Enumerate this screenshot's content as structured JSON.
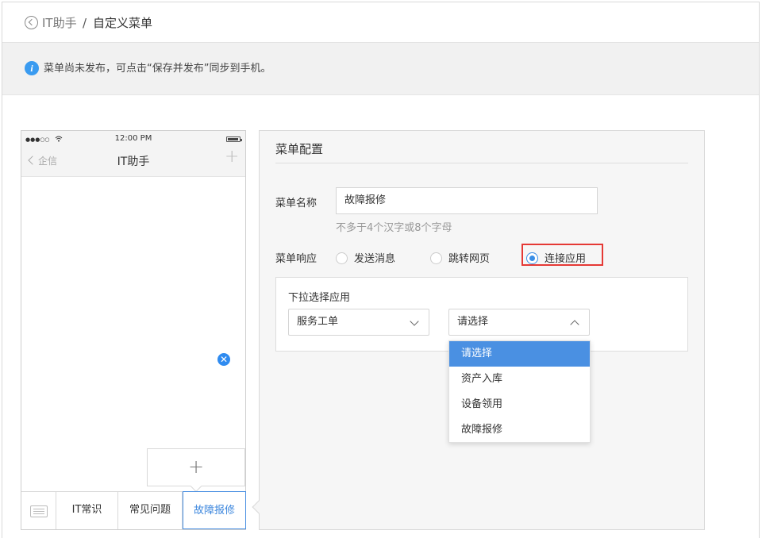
{
  "header": {
    "breadcrumb_link": "IT助手",
    "separator": "/",
    "current": "自定义菜单"
  },
  "notice": {
    "text": "菜单尚未发布，可点击“保存并发布”同步到手机。"
  },
  "phone": {
    "signal": "●●●○○",
    "time": "12:00 PM",
    "nav_back": "企信",
    "nav_title": "IT助手",
    "nav_plus": "+",
    "add_plus": "+",
    "tabs": [
      "IT常识",
      "常见问题",
      "故障报修"
    ],
    "active_tab": "故障报修",
    "close_badge": "✕"
  },
  "config": {
    "title": "菜单配置",
    "name_label": "菜单名称",
    "name_value": "故障报修",
    "name_hint": "不多于4个汉字或8个字母",
    "response_label": "菜单响应",
    "response_options": [
      "发送消息",
      "跳转网页",
      "连接应用"
    ],
    "response_selected": "连接应用",
    "app_section_title": "下拉选择应用",
    "app_select_value": "服务工单",
    "sub_select_value": "请选择",
    "dropdown_options": [
      "请选择",
      "资产入库",
      "设备领用",
      "故障报修"
    ],
    "dropdown_selected": "请选择"
  },
  "colors": {
    "accent": "#4a90e2",
    "highlight_box": "#e53935",
    "info_icon": "#3a9bf0"
  }
}
